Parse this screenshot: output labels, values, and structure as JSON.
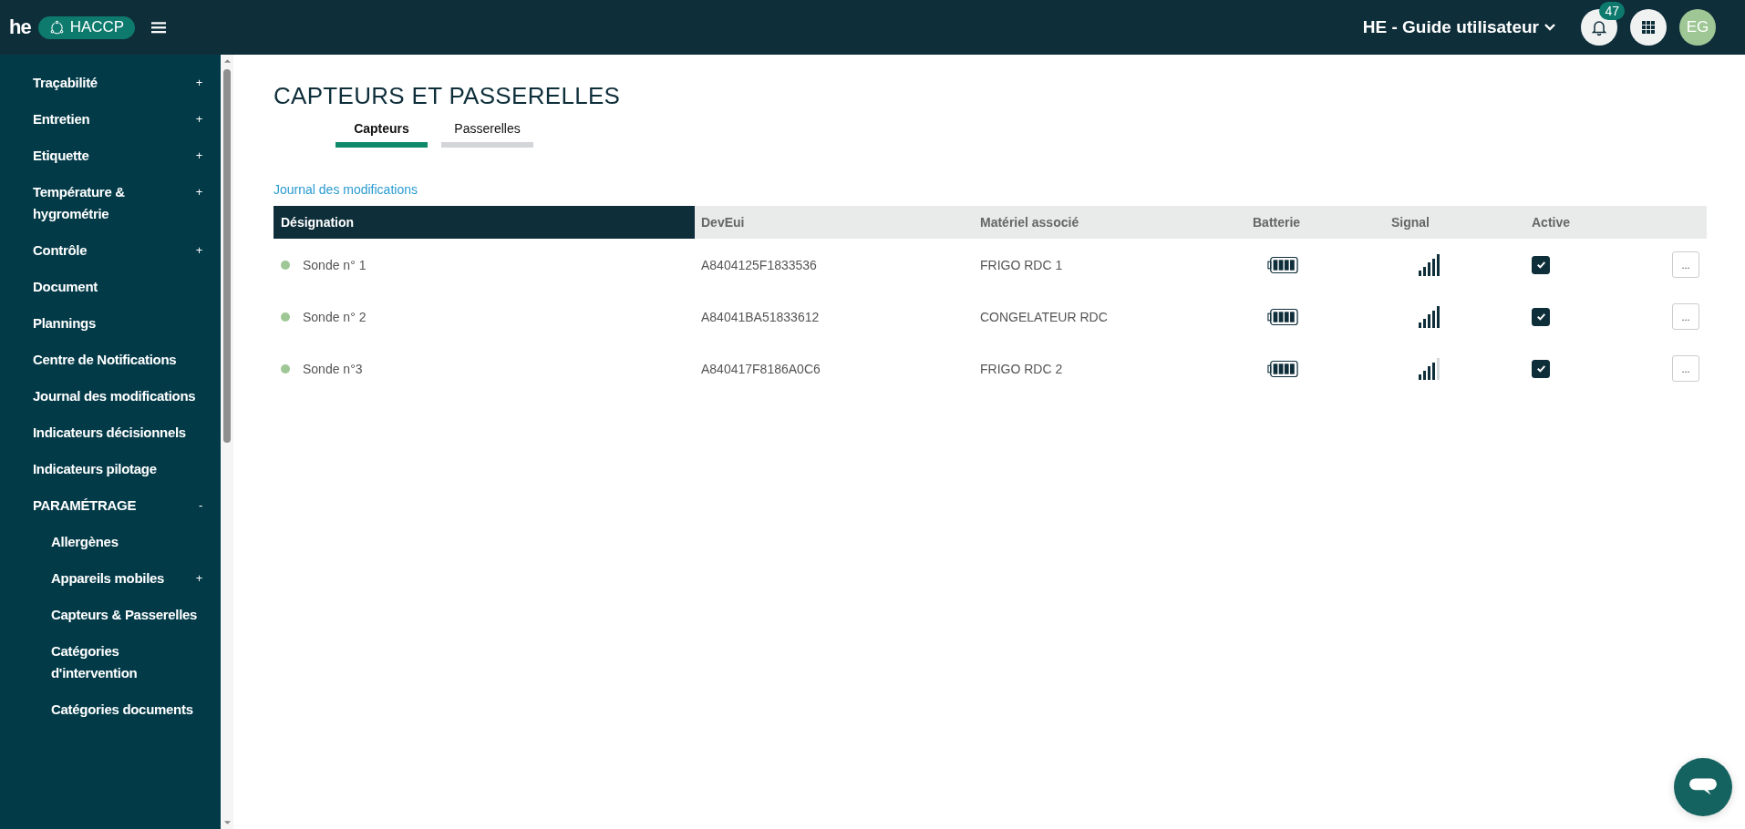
{
  "header": {
    "logo": "he",
    "app_badge": "HACCP",
    "site_title": "HE - Guide utilisateur",
    "notification_count": "47",
    "avatar": "EG"
  },
  "sidebar": {
    "items": [
      {
        "label": "Traçabilité",
        "sign": "+"
      },
      {
        "label": "Entretien",
        "sign": "+"
      },
      {
        "label": "Etiquette",
        "sign": "+"
      },
      {
        "label": "Température & hygrométrie",
        "sign": "+"
      },
      {
        "label": "Contrôle",
        "sign": "+"
      },
      {
        "label": "Document"
      },
      {
        "label": "Plannings"
      },
      {
        "label": "Centre de Notifications"
      },
      {
        "label": "Journal des modifications"
      },
      {
        "label": "Indicateurs décisionnels"
      },
      {
        "label": "Indicateurs pilotage"
      },
      {
        "label": "PARAMÉTRAGE",
        "sign": "-",
        "children": [
          {
            "label": "Allergènes"
          },
          {
            "label": "Appareils mobiles",
            "sign": "+"
          },
          {
            "label": "Capteurs & Passerelles"
          },
          {
            "label": "Catégories d'intervention"
          },
          {
            "label": "Catégories documents"
          }
        ]
      }
    ]
  },
  "page": {
    "title": "CAPTEURS ET PASSERELLES",
    "tabs": [
      {
        "label": "Capteurs",
        "selected": true
      },
      {
        "label": "Passerelles",
        "selected": false
      }
    ],
    "link": "Journal des modifications"
  },
  "table": {
    "columns": [
      "Désignation",
      "DevEui",
      "Matériel associé",
      "Batterie",
      "Signal",
      "Active"
    ],
    "rows": [
      {
        "name": "Sonde n° 1",
        "deveui": "A8404125F1833536",
        "equipment": "FRIGO RDC 1",
        "signal_full": true,
        "active": true,
        "action": "..."
      },
      {
        "name": "Sonde n° 2",
        "deveui": "A84041BA51833612",
        "equipment": "CONGELATEUR RDC",
        "signal_full": true,
        "active": true,
        "action": "..."
      },
      {
        "name": "Sonde n°3",
        "deveui": "A840417F8186A0C6",
        "equipment": "FRIGO RDC 2",
        "signal_full": false,
        "active": true,
        "action": "..."
      }
    ]
  }
}
